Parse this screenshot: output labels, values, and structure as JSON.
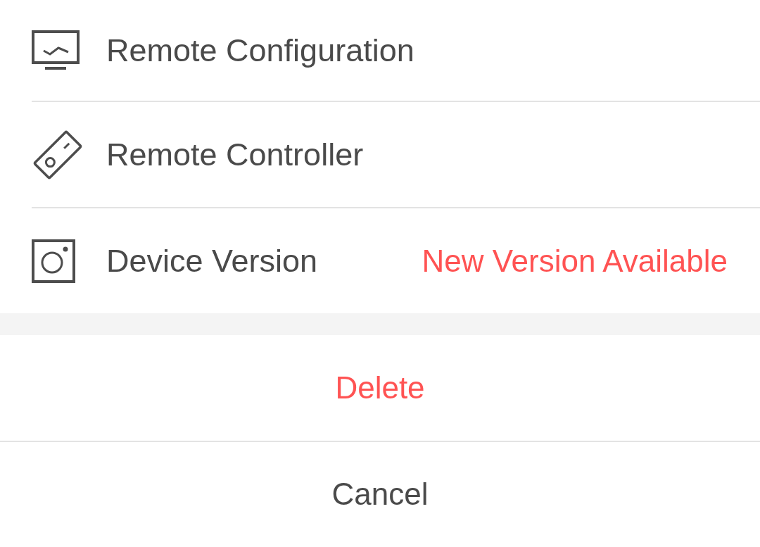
{
  "menu": {
    "items": [
      {
        "label": "Remote Configuration"
      },
      {
        "label": "Remote Controller"
      },
      {
        "label": "Device Version",
        "status": "New Version Available"
      }
    ]
  },
  "actions": [
    {
      "label": "Delete",
      "kind": "danger"
    },
    {
      "label": "Cancel",
      "kind": "default"
    }
  ]
}
